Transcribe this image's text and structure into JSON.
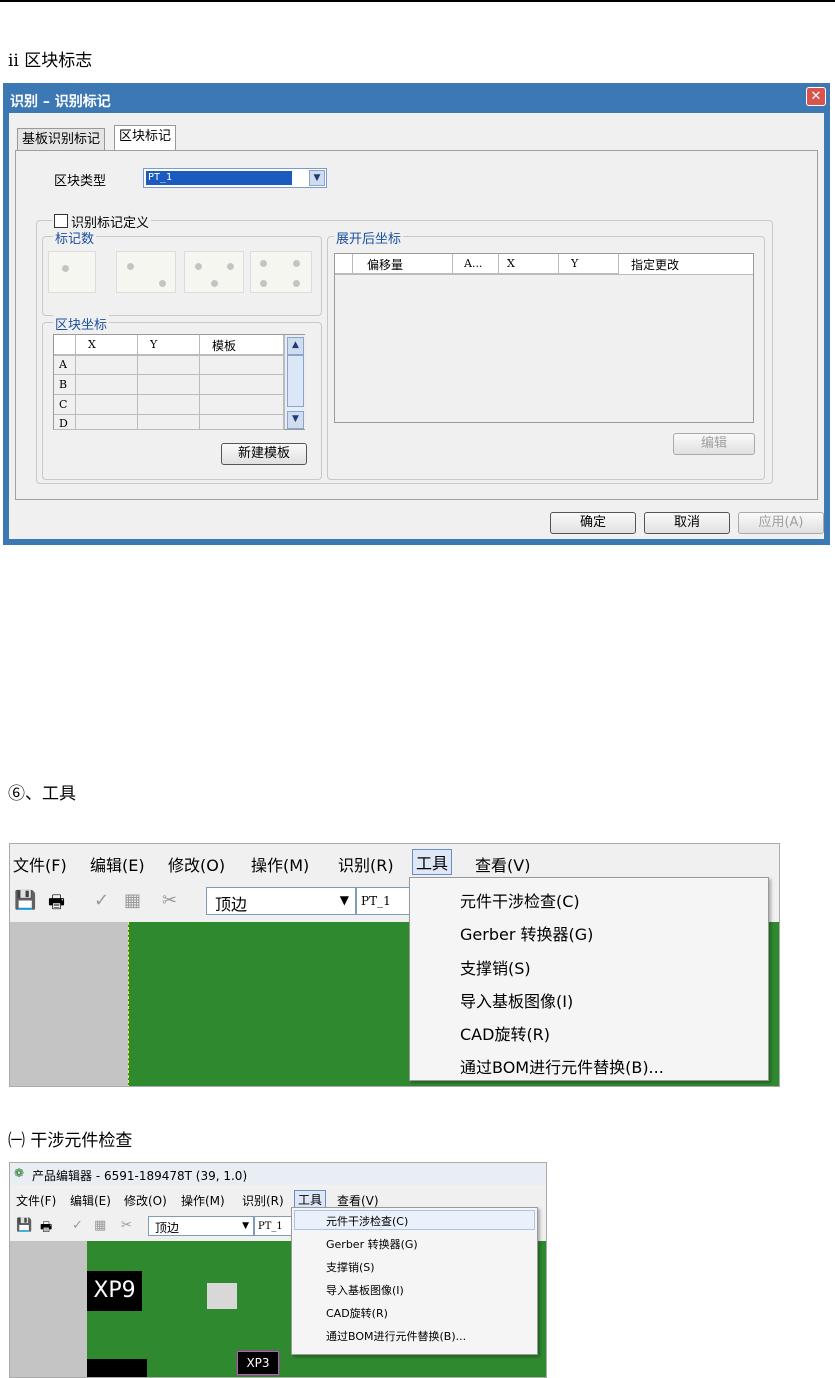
{
  "section_headings": {
    "block_mark": "ii  区块标志",
    "tools": "⑥、工具",
    "interference": "㈠ 干涉元件检查"
  },
  "dialog": {
    "title": "识别  –  识别标记",
    "close_glyph": "✕",
    "tabs": [
      "基板识别标记",
      "区块标记"
    ],
    "block_type_label": "区块类型",
    "block_type_value": "PT_1",
    "mark_def_label": "识别标记定义",
    "mark_count_label": "标记数",
    "block_coords_label": "区块坐标",
    "block_table": {
      "columns": [
        "X",
        "Y",
        "模板"
      ],
      "rows": [
        "A",
        "B",
        "C",
        "D"
      ]
    },
    "new_template_button": "新建模板",
    "expanded_coords_label": "展开后坐标",
    "expanded_table_columns": [
      "偏移量",
      "A...",
      "X",
      "Y",
      "指定更改"
    ],
    "edit_button": "编辑",
    "ok_button": "确定",
    "cancel_button": "取消",
    "apply_button": "应用(A)"
  },
  "tools_menu_shot": {
    "menubar": [
      "文件(F)",
      "编辑(E)",
      "修改(O)",
      "操作(M)",
      "识别(R)",
      "工具",
      "查看(V)"
    ],
    "side_dropdown": "顶边",
    "panel_dropdown": "PT_1",
    "menu_items": [
      "元件干涉检查(C)",
      "Gerber 转换器(G)",
      "支撑销(S)",
      "导入基板图像(I)",
      "CAD旋转(R)",
      "通过BOM进行元件替换(B)..."
    ]
  },
  "editor_shot": {
    "title": "产品编辑器 - 6591-189478T (39, 1.0)",
    "menubar": [
      "文件(F)",
      "编辑(E)",
      "修改(O)",
      "操作(M)",
      "识别(R)",
      "工具",
      "查看(V)"
    ],
    "side_dropdown": "顶边",
    "panel_dropdown": "PT_1",
    "menu_items": [
      "元件干涉检查(C)",
      "Gerber 转换器(G)",
      "支撑销(S)",
      "导入基板图像(I)",
      "CAD旋转(R)",
      "通过BOM进行元件替换(B)..."
    ],
    "component_labels": [
      "XP9",
      "XP3"
    ]
  }
}
